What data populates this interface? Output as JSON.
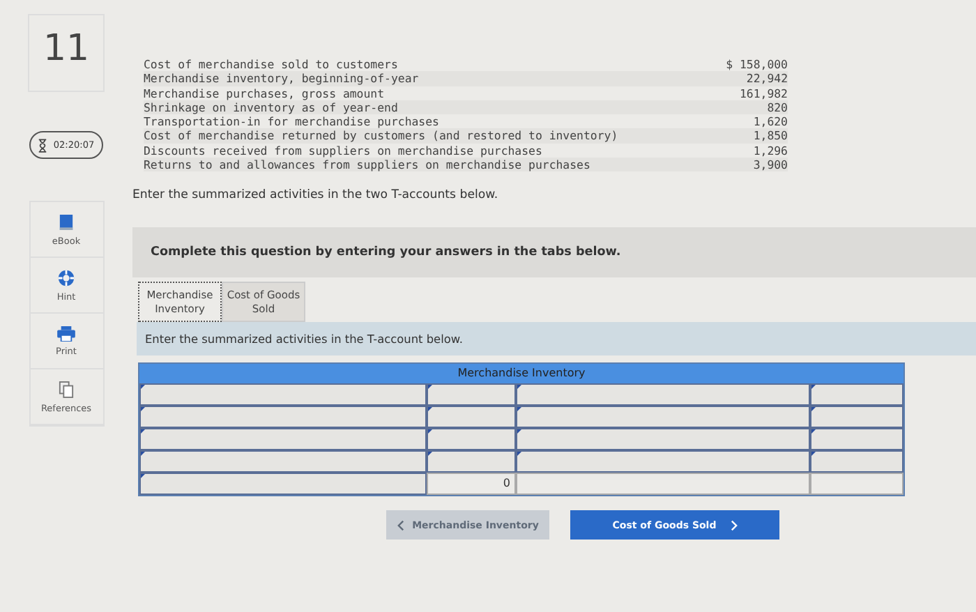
{
  "question_number": "11",
  "timer": "02:20:07",
  "tools": [
    {
      "kind": "ebook",
      "label": "eBook"
    },
    {
      "kind": "hint",
      "label": "Hint"
    },
    {
      "kind": "print",
      "label": "Print"
    },
    {
      "kind": "references",
      "label": "References"
    }
  ],
  "data_table": {
    "rows": [
      {
        "label": "Cost of merchandise sold to customers",
        "amount": "$ 158,000"
      },
      {
        "label": "Merchandise inventory, beginning-of-year",
        "amount": "22,942"
      },
      {
        "label": "Merchandise purchases, gross amount",
        "amount": "161,982"
      },
      {
        "label": "Shrinkage on inventory as of year-end",
        "amount": "820"
      },
      {
        "label": "Transportation-in for merchandise purchases",
        "amount": "1,620"
      },
      {
        "label": "Cost of merchandise returned by customers (and restored to inventory)",
        "amount": "1,850"
      },
      {
        "label": "Discounts received from suppliers on merchandise purchases",
        "amount": "1,296"
      },
      {
        "label": "Returns to and allowances from suppliers on merchandise purchases",
        "amount": "3,900"
      }
    ]
  },
  "instruction": "Enter the summarized activities in the two T-accounts below.",
  "banner": "Complete this question by entering your answers in the tabs below.",
  "tabs": [
    {
      "label": "Merchandise Inventory",
      "selected": true
    },
    {
      "label": "Cost of Goods Sold",
      "selected": false
    }
  ],
  "tab_instruction": "Enter the summarized activities in the T-account below.",
  "t_account": {
    "title": "Merchandise Inventory",
    "rows": [
      {
        "cells": [
          {
            "editable": true
          },
          {
            "editable": true
          },
          {
            "editable": true
          },
          {
            "editable": true
          }
        ]
      },
      {
        "cells": [
          {
            "editable": true
          },
          {
            "editable": true
          },
          {
            "editable": true
          },
          {
            "editable": true
          }
        ]
      },
      {
        "cells": [
          {
            "editable": true
          },
          {
            "editable": true
          },
          {
            "editable": true
          },
          {
            "editable": true
          }
        ]
      },
      {
        "cells": [
          {
            "editable": true
          },
          {
            "editable": true
          },
          {
            "editable": true
          },
          {
            "editable": true
          }
        ]
      },
      {
        "cells": [
          {
            "editable": true
          },
          {
            "editable": false,
            "value": "0"
          },
          {
            "editable": false
          },
          {
            "editable": false
          }
        ]
      }
    ]
  },
  "nav_buttons": [
    {
      "kind": "prev",
      "label": "Merchandise Inventory",
      "disabled": true
    },
    {
      "kind": "next",
      "label": "Cost of Goods Sold",
      "disabled": false
    }
  ]
}
